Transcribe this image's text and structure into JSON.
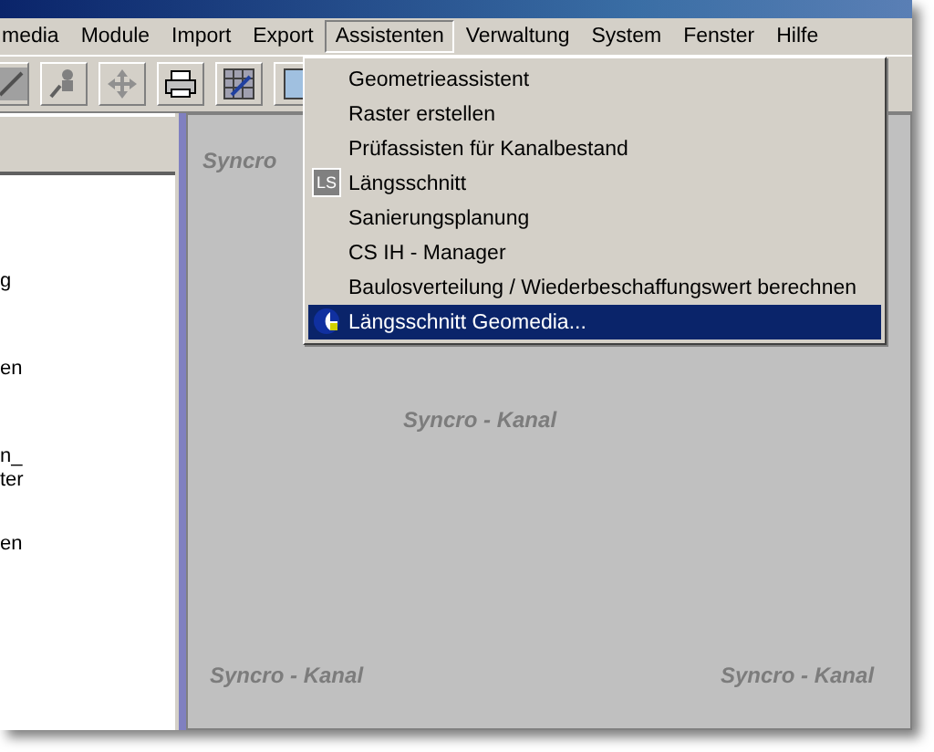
{
  "menu_bar": [
    {
      "label": "media",
      "selected": false
    },
    {
      "label": "Module",
      "selected": false
    },
    {
      "label": "Import",
      "selected": false
    },
    {
      "label": "Export",
      "selected": false
    },
    {
      "label": "Assistenten",
      "selected": true
    },
    {
      "label": "Verwaltung",
      "selected": false
    },
    {
      "label": "System",
      "selected": false
    },
    {
      "label": "Fenster",
      "selected": false
    },
    {
      "label": "Hilfe",
      "selected": false
    }
  ],
  "toolbar": [
    {
      "kind": "partial"
    },
    {
      "kind": "figure"
    },
    {
      "kind": "move"
    },
    {
      "kind": "print"
    },
    {
      "kind": "chart"
    },
    {
      "kind": "map"
    }
  ],
  "dropdown": [
    {
      "kind": "plain",
      "label": "Geometrieassistent",
      "selected": false
    },
    {
      "kind": "plain",
      "label": "Raster erstellen",
      "selected": false
    },
    {
      "kind": "plain",
      "label": "Prüfassisten für Kanalbestand",
      "selected": false
    },
    {
      "kind": "badge",
      "label": "Längsschnitt",
      "selected": false,
      "icon_text": "LS"
    },
    {
      "kind": "plain",
      "label": "Sanierungsplanung",
      "selected": false
    },
    {
      "kind": "plain",
      "label": "CS IH - Manager",
      "selected": false
    },
    {
      "kind": "plain",
      "label": "Baulosverteilung / Wiederbeschaffungswert berechnen",
      "selected": false
    },
    {
      "kind": "image",
      "label": "Längsschnitt Geomedia...",
      "selected": true
    }
  ],
  "left_panel": {
    "items": [
      {
        "lines": [
          "g"
        ]
      },
      {
        "lines": [
          "en"
        ]
      },
      {
        "lines": [
          "n_",
          "ter"
        ]
      },
      {
        "lines": [
          "en"
        ]
      }
    ]
  },
  "workspace": {
    "background_texts": [
      "Syncro",
      "Syncro - Kanal",
      "Syncro - Kanal",
      "Syncro - Kanal"
    ]
  }
}
